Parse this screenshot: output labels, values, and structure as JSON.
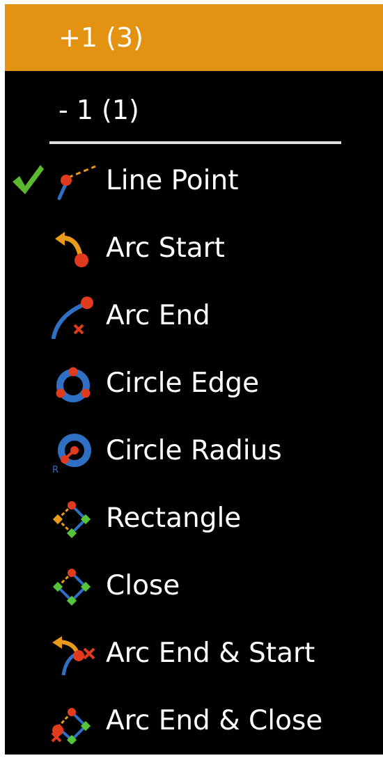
{
  "step_options": [
    {
      "label": "+1 (3)",
      "active": true
    },
    {
      "label": "- 1 (1)",
      "active": false
    }
  ],
  "items": [
    {
      "label": "Line Point",
      "icon": "line-point-icon",
      "checked": true
    },
    {
      "label": "Arc Start",
      "icon": "arc-start-icon",
      "checked": false
    },
    {
      "label": "Arc End",
      "icon": "arc-end-icon",
      "checked": false
    },
    {
      "label": "Circle Edge",
      "icon": "circle-edge-icon",
      "checked": false
    },
    {
      "label": "Circle Radius",
      "icon": "circle-radius-icon",
      "checked": false
    },
    {
      "label": "Rectangle",
      "icon": "rectangle-icon",
      "checked": false
    },
    {
      "label": "Close",
      "icon": "close-shape-icon",
      "checked": false
    },
    {
      "label": "Arc End & Start",
      "icon": "arc-end-start-icon",
      "checked": false
    },
    {
      "label": "Arc End & Close",
      "icon": "arc-end-close-icon",
      "checked": false
    }
  ],
  "colors": {
    "menu_background": "#000000",
    "active_highlight": "#e39212",
    "text": "#ffffff",
    "separator": "#e0e0e0",
    "check": "#5cb82e",
    "point_red": "#e23a1e",
    "stroke_blue": "#2f6fc4",
    "guide_orange": "#e89a1a",
    "vertex_green": "#57c53a"
  }
}
